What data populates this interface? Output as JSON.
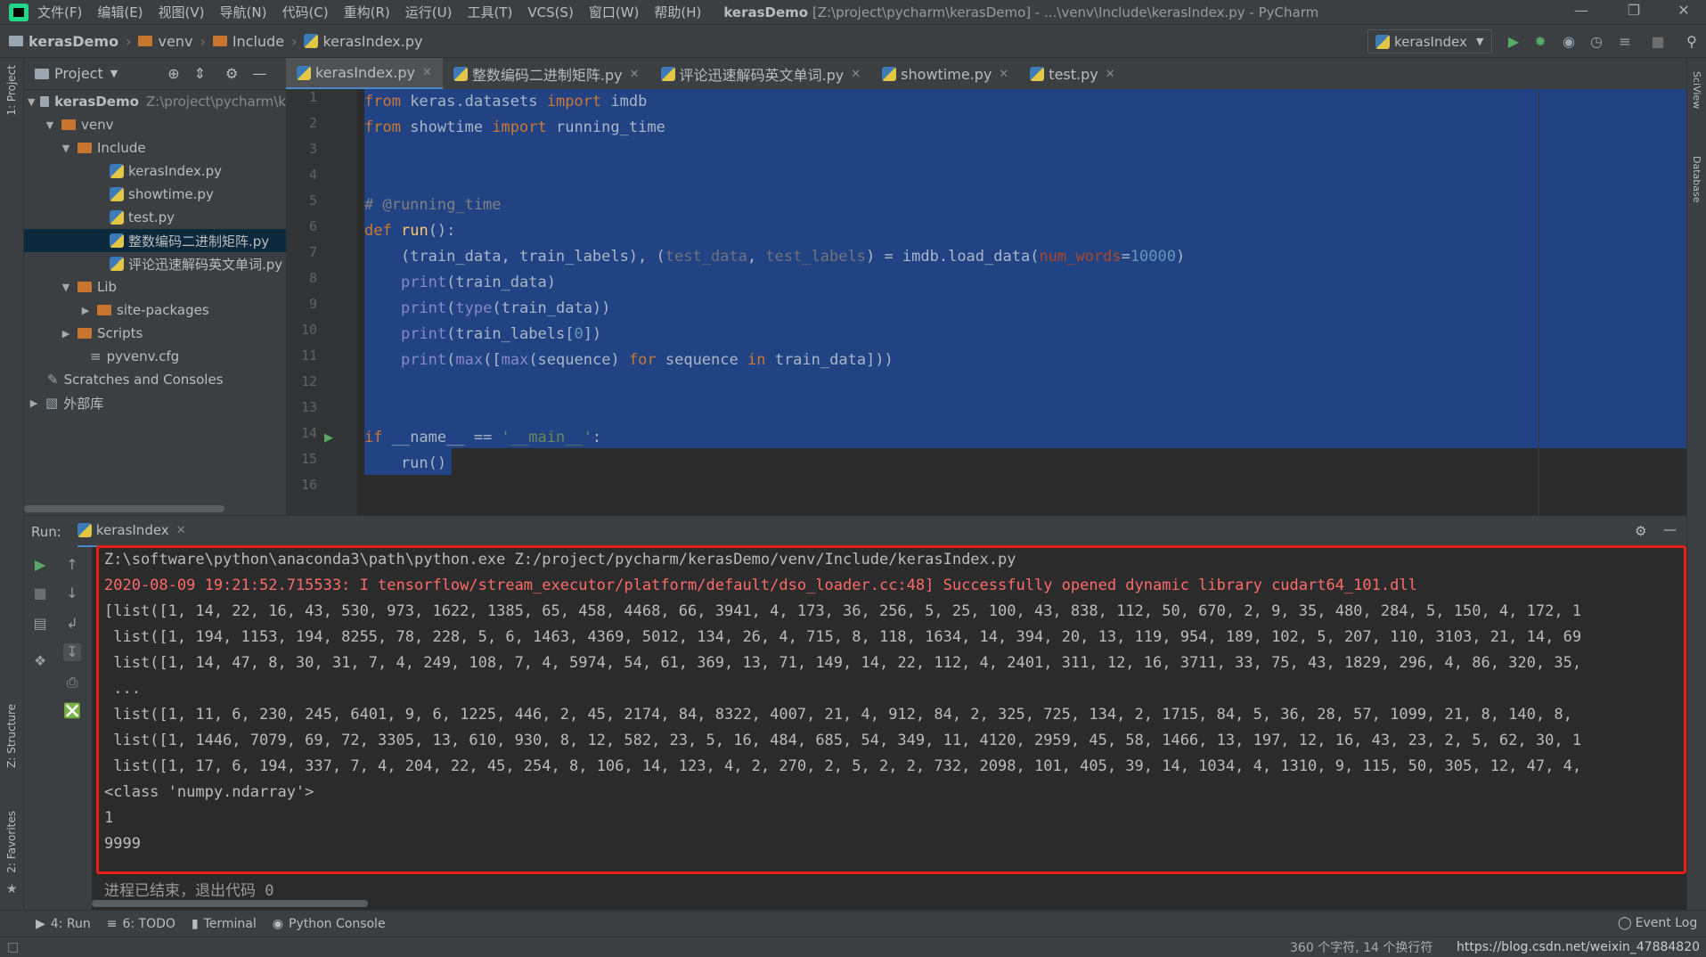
{
  "menubar": {
    "items": [
      "文件(F)",
      "编辑(E)",
      "视图(V)",
      "导航(N)",
      "代码(C)",
      "重构(R)",
      "运行(U)",
      "工具(T)",
      "VCS(S)",
      "窗口(W)",
      "帮助(H)"
    ],
    "title_project": "kerasDemo",
    "title_rest": "[Z:\\project\\pycharm\\kerasDemo] - ...\\venv\\Include\\kerasIndex.py - PyCharm"
  },
  "navbar": {
    "crumbs": [
      "kerasDemo",
      "venv",
      "Include",
      "kerasIndex.py"
    ],
    "run_config": "kerasIndex"
  },
  "project": {
    "header": "Project",
    "side_label": "1: Project",
    "tree": [
      {
        "label": "kerasDemo",
        "extra": "Z:\\project\\pycharm\\k",
        "type": "root"
      },
      {
        "label": "venv",
        "type": "folder"
      },
      {
        "label": "Include",
        "type": "folder"
      },
      {
        "label": "kerasIndex.py",
        "type": "py"
      },
      {
        "label": "showtime.py",
        "type": "py"
      },
      {
        "label": "test.py",
        "type": "py"
      },
      {
        "label": "整数编码二进制矩阵.py",
        "type": "py"
      },
      {
        "label": "评论迅速解码英文单词.py",
        "type": "py"
      },
      {
        "label": "Lib",
        "type": "folder"
      },
      {
        "label": "site-packages",
        "type": "folder"
      },
      {
        "label": "Scripts",
        "type": "folder"
      },
      {
        "label": "pyvenv.cfg",
        "type": "file"
      },
      {
        "label": "Scratches and Consoles",
        "type": "scratch"
      },
      {
        "label": "外部库",
        "type": "lib"
      }
    ]
  },
  "tabs": [
    "kerasIndex.py",
    "整数编码二进制矩阵.py",
    "评论迅速解码英文单词.py",
    "showtime.py",
    "test.py"
  ],
  "editor": {
    "line_numbers": [
      "1",
      "2",
      "3",
      "4",
      "5",
      "6",
      "7",
      "8",
      "9",
      "10",
      "11",
      "12",
      "13",
      "14",
      "15",
      "16"
    ]
  },
  "run": {
    "label": "Run:",
    "config": "kerasIndex",
    "console": [
      "Z:\\software\\python\\anaconda3\\path\\python.exe Z:/project/pycharm/kerasDemo/venv/Include/kerasIndex.py",
      "2020-08-09 19:21:52.715533: I tensorflow/stream_executor/platform/default/dso_loader.cc:48] Successfully opened dynamic library cudart64_101.dll",
      "[list([1, 14, 22, 16, 43, 530, 973, 1622, 1385, 65, 458, 4468, 66, 3941, 4, 173, 36, 256, 5, 25, 100, 43, 838, 112, 50, 670, 2, 9, 35, 480, 284, 5, 150, 4, 172, 1",
      " list([1, 194, 1153, 194, 8255, 78, 228, 5, 6, 1463, 4369, 5012, 134, 26, 4, 715, 8, 118, 1634, 14, 394, 20, 13, 119, 954, 189, 102, 5, 207, 110, 3103, 21, 14, 69",
      " list([1, 14, 47, 8, 30, 31, 7, 4, 249, 108, 7, 4, 5974, 54, 61, 369, 13, 71, 149, 14, 22, 112, 4, 2401, 311, 12, 16, 3711, 33, 75, 43, 1829, 296, 4, 86, 320, 35,",
      " ...",
      " list([1, 11, 6, 230, 245, 6401, 9, 6, 1225, 446, 2, 45, 2174, 84, 8322, 4007, 21, 4, 912, 84, 2, 325, 725, 134, 2, 1715, 84, 5, 36, 28, 57, 1099, 21, 8, 140, 8,",
      " list([1, 1446, 7079, 69, 72, 3305, 13, 610, 930, 8, 12, 582, 23, 5, 16, 484, 685, 54, 349, 11, 4120, 2959, 45, 58, 1466, 13, 197, 12, 16, 43, 23, 2, 5, 62, 30, 1",
      " list([1, 17, 6, 194, 337, 7, 4, 204, 22, 45, 254, 8, 106, 14, 123, 4, 2, 270, 2, 5, 2, 2, 732, 2098, 101, 405, 39, 14, 1034, 4, 1310, 9, 115, 50, 305, 12, 47, 4,",
      "<class 'numpy.ndarray'>",
      "1",
      "9999"
    ],
    "exit_message": "进程已结束，退出代码 0"
  },
  "side_labels": {
    "structure": "Z: Structure",
    "favorites": "2: Favorites",
    "sciview": "SciView",
    "database": "Database"
  },
  "bottom_tools": [
    "4: Run",
    "6: TODO",
    "Terminal",
    "Python Console"
  ],
  "event_log": "Event Log",
  "status": {
    "left": "360 个字符, 14 个换行符",
    "rest": "https://blog.csdn.net/weixin_47884820"
  }
}
